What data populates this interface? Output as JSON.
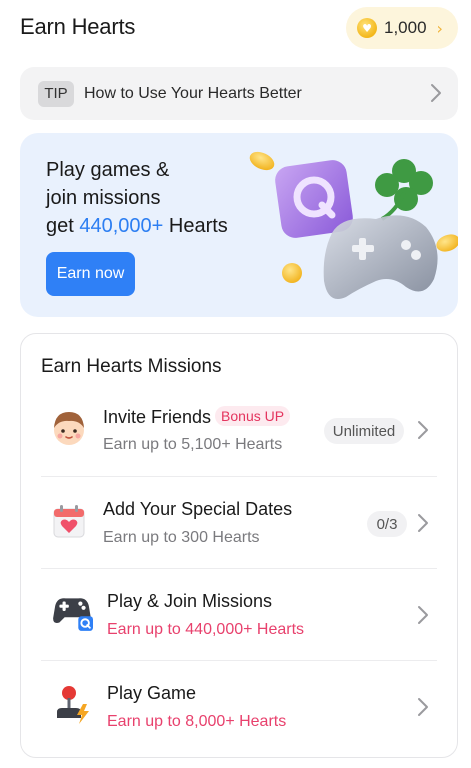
{
  "header": {
    "title": "Earn Hearts",
    "balance": "1,000",
    "coin_icon": "heart-coin-icon"
  },
  "tip": {
    "badge": "TIP",
    "text": "How to Use Your Hearts Better"
  },
  "banner": {
    "line1": "Play games &",
    "line2": "join missions",
    "line3_prefix": "get ",
    "line3_highlight": "440,000+",
    "line3_suffix": " Hearts",
    "cta": "Earn now"
  },
  "missions": {
    "title": "Earn Hearts Missions",
    "items": [
      {
        "title": "Invite Friends",
        "badge": "Bonus UP",
        "subtitle": "Earn up to 5,100+ Hearts",
        "status": "Unlimited",
        "icon": "friend-face-icon"
      },
      {
        "title": "Add Your Special Dates",
        "subtitle": "Earn up to 300 Hearts",
        "status": "0/3",
        "icon": "calendar-heart-icon"
      },
      {
        "title": "Play & Join Missions",
        "subtitle": "Earn up to 440,000+ Hearts",
        "icon": "gamepad-icon"
      },
      {
        "title": "Play Game",
        "subtitle": "Earn up to 8,000+ Hearts",
        "icon": "joystick-icon"
      }
    ]
  },
  "colors": {
    "accent": "#2f80f6",
    "pink": "#e8416d",
    "banner_bg": "#e9f1fd",
    "balance_bg": "#fdf5dc"
  }
}
